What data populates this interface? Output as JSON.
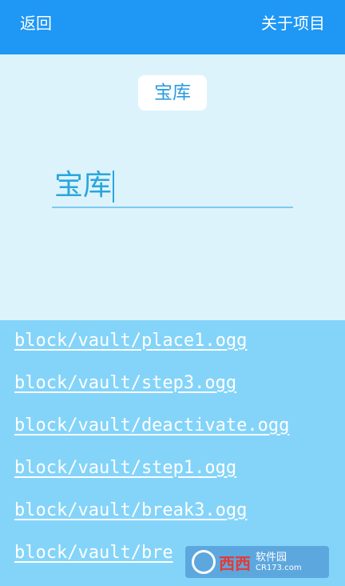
{
  "header": {
    "back_label": "返回",
    "about_label": "关于项目"
  },
  "chip": {
    "label": "宝库"
  },
  "search": {
    "value": "宝库"
  },
  "results": [
    "block/vault/place1.ogg",
    "block/vault/step3.ogg",
    "block/vault/deactivate.ogg",
    "block/vault/step1.ogg",
    "block/vault/break3.ogg",
    "block/vault/bre"
  ],
  "watermark": {
    "main": "西西",
    "title": "软件园",
    "subtitle": "CR173.com"
  },
  "colors": {
    "header_bg": "#1e97f5",
    "upper_bg": "#ddf3fc",
    "list_bg": "#84d4f9",
    "accent_text": "#29a6dc"
  }
}
